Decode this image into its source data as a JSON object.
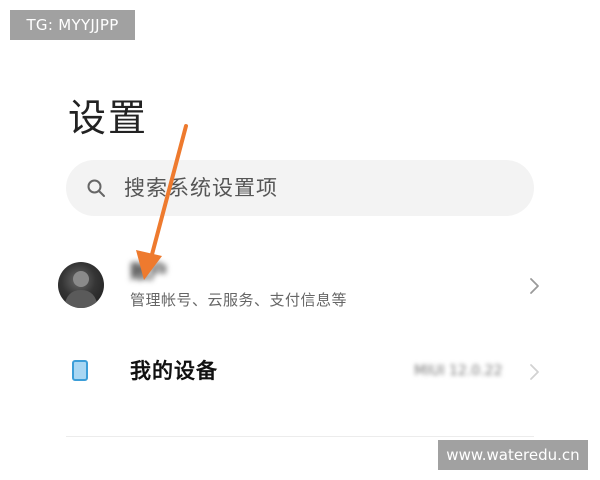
{
  "watermarks": {
    "top_left": "TG: MYYJJPP",
    "bottom_right": "www.wateredu.cn"
  },
  "header": {
    "title": "设置"
  },
  "search": {
    "placeholder": "搜索系统设置项",
    "icon": "search-icon"
  },
  "account": {
    "name": "账户",
    "description": "管理帐号、云服务、支付信息等",
    "avatar": "avatar"
  },
  "device": {
    "label": "我的设备",
    "version": "MIUI 12.0.22",
    "icon": "phone-icon"
  },
  "colors": {
    "arrow": "#ee7a2e",
    "device_icon": "#3c9ed8",
    "search_background": "#f3f3f3"
  }
}
